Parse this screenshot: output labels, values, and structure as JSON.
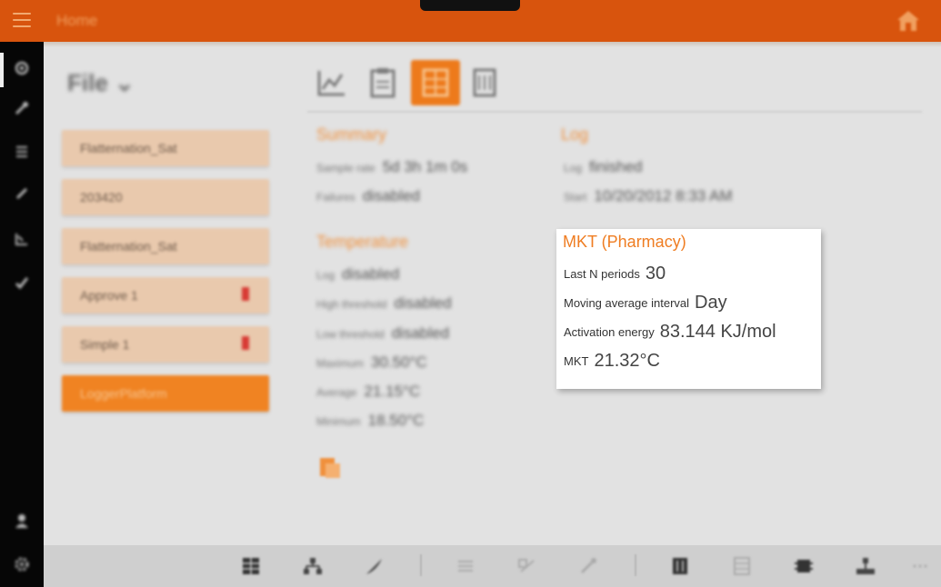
{
  "header": {
    "title": "Home",
    "icons": {
      "menu": "hamburger-icon",
      "home": "home-icon"
    },
    "accent_color": "#d8540d"
  },
  "nav_rail": {
    "icons": [
      "home-icon",
      "wrench-icon",
      "list-icon",
      "link-icon",
      "chart-icon",
      "check-icon",
      "user-icon",
      "gear-icon"
    ]
  },
  "file_panel": {
    "title": "File",
    "items": [
      {
        "label": "Flatternation_Sat",
        "flag": false,
        "active": false
      },
      {
        "label": "203420",
        "flag": false,
        "active": false
      },
      {
        "label": "Flatternation_Sat",
        "flag": false,
        "active": false
      },
      {
        "label": "Approve 1",
        "flag": true,
        "active": false
      },
      {
        "label": "Simple 1",
        "flag": true,
        "active": false
      },
      {
        "label": "LoggerPlatform",
        "flag": false,
        "active": true
      }
    ]
  },
  "toolbar": {
    "icons": [
      "chart-icon",
      "clipboard-icon",
      "grid-icon",
      "database-icon"
    ],
    "active_index": 2
  },
  "summary": {
    "heading": "Summary",
    "rows": [
      {
        "label": "Sample rate",
        "value": "5d 3h 1m 0s"
      },
      {
        "label": "Failures",
        "value": "disabled"
      }
    ]
  },
  "log": {
    "heading": "Log",
    "rows": [
      {
        "label": "Log",
        "value": "finished"
      },
      {
        "label": "Start",
        "value": "10/20/2012 8:33 AM"
      }
    ]
  },
  "temperature": {
    "heading": "Temperature",
    "rows": [
      {
        "label": "Log",
        "value": "disabled"
      },
      {
        "label": "High threshold",
        "value": "disabled"
      },
      {
        "label": "Low threshold",
        "value": "disabled"
      },
      {
        "label": "Maximum",
        "value": "30.50°C"
      },
      {
        "label": "Average",
        "value": "21.15°C"
      },
      {
        "label": "Minimum",
        "value": "18.50°C"
      }
    ]
  },
  "mkt": {
    "title": "MKT (Pharmacy)",
    "rows": [
      {
        "label": "Last N periods",
        "value": "30"
      },
      {
        "label": "Moving average interval",
        "value": "Day"
      },
      {
        "label": "Activation energy",
        "value": "83.144 KJ/mol"
      },
      {
        "label": "MKT",
        "value": "21.32°C"
      }
    ]
  },
  "bottom_bar": {
    "icons": [
      "grid-icon",
      "sitemap-icon",
      "feather-icon",
      "list-icon",
      "link-icon",
      "wrench-icon",
      "database-icon",
      "table-icon",
      "chip-icon",
      "network-icon",
      "more-icon"
    ]
  }
}
